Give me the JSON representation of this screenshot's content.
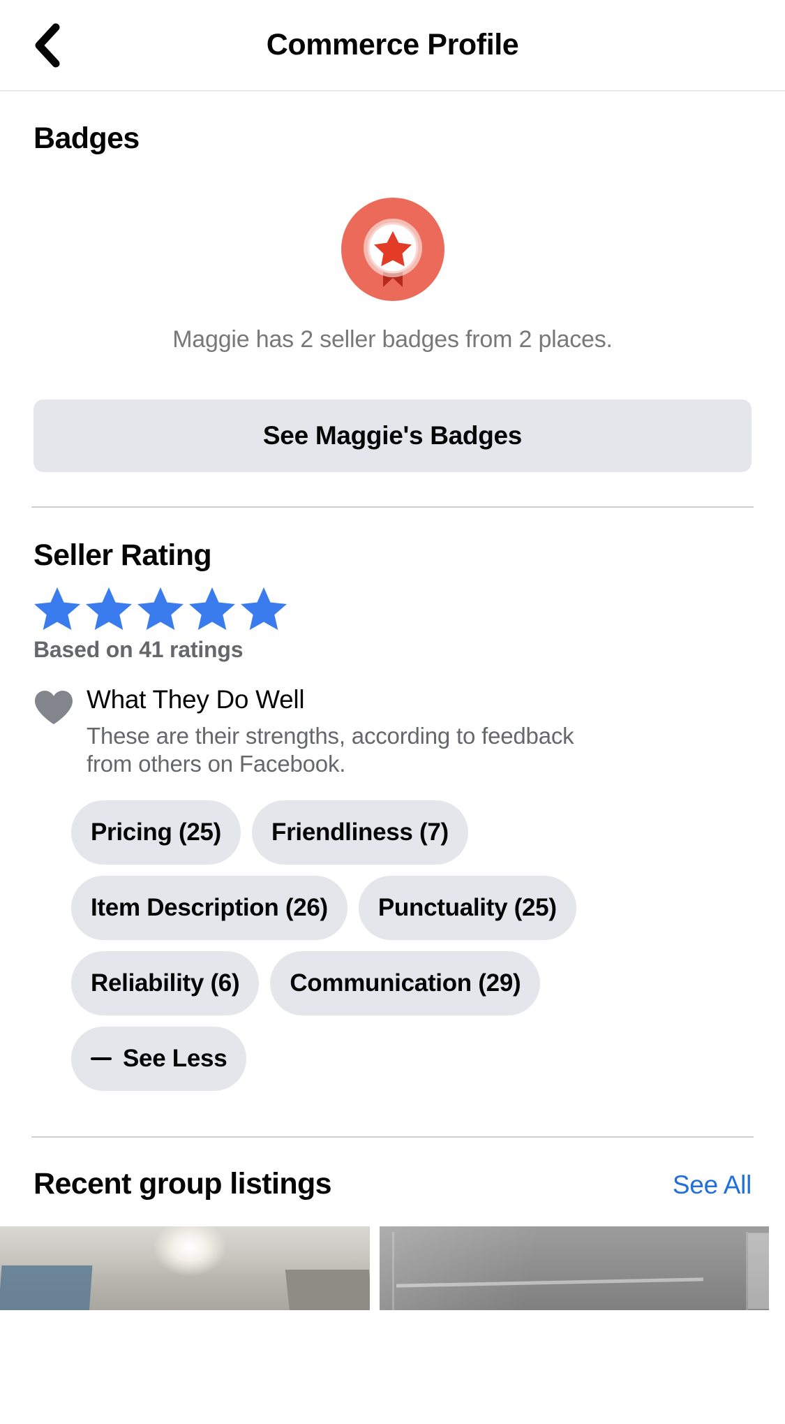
{
  "header": {
    "title": "Commerce Profile",
    "back_icon": "chevron-left-icon"
  },
  "badges": {
    "title": "Badges",
    "badge_icon": "award-ribbon-badge-icon",
    "caption": "Maggie has 2 seller badges from 2 places.",
    "button_label": "See Maggie's Badges"
  },
  "seller_rating": {
    "title": "Seller Rating",
    "stars_filled": 5,
    "stars_total": 5,
    "star_color": "#3a7ced",
    "based_on": "Based on 41 ratings",
    "what_they_do_well": {
      "icon": "heart-icon",
      "title": "What They Do Well",
      "description": "These are their strengths, according to feedback from others on Facebook."
    },
    "tag_rows": [
      [
        {
          "label": "Pricing (25)",
          "name": "Pricing",
          "count": 25
        },
        {
          "label": "Friendliness (7)",
          "name": "Friendliness",
          "count": 7
        }
      ],
      [
        {
          "label": "Item Description (26)",
          "name": "Item Description",
          "count": 26
        },
        {
          "label": "Punctuality (25)",
          "name": "Punctuality",
          "count": 25
        }
      ],
      [
        {
          "label": "Reliability (6)",
          "name": "Reliability",
          "count": 6
        },
        {
          "label": "Communication (29)",
          "name": "Communication",
          "count": 29
        }
      ]
    ],
    "see_less_label": "See Less"
  },
  "recent_listings": {
    "title": "Recent group listings",
    "see_all_label": "See All",
    "thumbnails": [
      {
        "alt": "listing-photo-room-interior"
      },
      {
        "alt": "listing-photo-garage-door"
      }
    ]
  },
  "colors": {
    "accent_blue": "#216fdb",
    "star_blue": "#3a7ced",
    "badge_red": "#eb6a5a",
    "pill_grey": "#e4e6eb",
    "text_primary": "#050505",
    "text_secondary": "#65676b"
  }
}
